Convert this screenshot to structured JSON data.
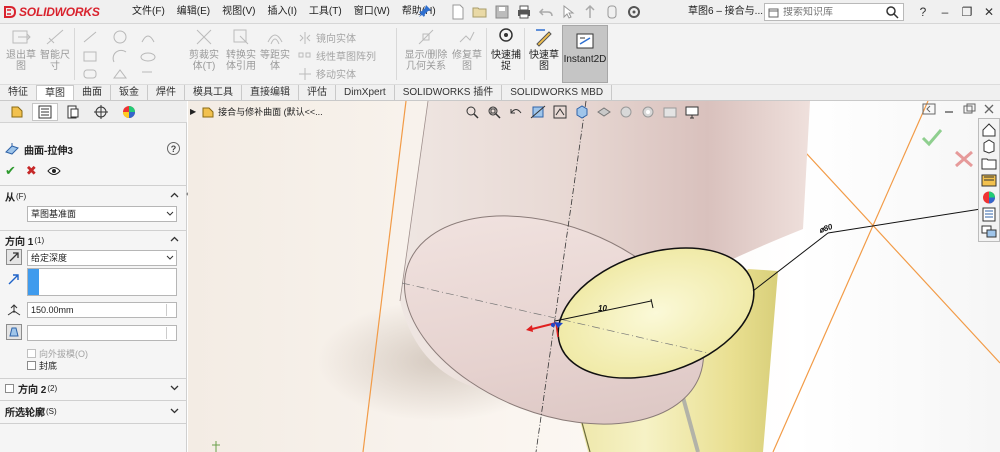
{
  "app": {
    "logo_text": "SOLIDWORKS",
    "doc_title": "草图6 – 接合与..."
  },
  "menu": [
    "文件(F)",
    "编辑(E)",
    "视图(V)",
    "插入(I)",
    "工具(T)",
    "窗口(W)",
    "帮助(H)"
  ],
  "search": {
    "placeholder": "搜索知识库"
  },
  "command_manager": {
    "exit_sketch": "退出草\n图",
    "smart_dim": "智能尺\n寸",
    "trim": "剪裁实\n体(T)",
    "convert": "转换实\n体引用",
    "offset": "等距实\n体",
    "mirror": "镜向实体",
    "linear_pattern": "线性草图阵列",
    "move": "移动实体",
    "display_delete": "显示/删除\n几何关系",
    "repair": "修复草\n图",
    "quick_snap": "快速捕\n捉",
    "rapid_sketch": "快速草\n图",
    "instant2d": "Instant2D"
  },
  "tabs": [
    "特征",
    "草图",
    "曲面",
    "钣金",
    "焊件",
    "模具工具",
    "直接编辑",
    "评估",
    "DimXpert",
    "SOLIDWORKS 插件",
    "SOLIDWORKS MBD"
  ],
  "active_tab": "草图",
  "property_manager": {
    "title": "曲面-拉伸3",
    "from_label": "从",
    "from_sub": "(F)",
    "from_value": "草图基准面",
    "dir1_label": "方向 1",
    "dir1_sub": "(1)",
    "end_condition": "给定深度",
    "depth": "150.00mm",
    "draft_outward": "向外拔模(O)",
    "cap_end": "封底",
    "dir2_label": "方向 2",
    "dir2_sub": "(2)",
    "contours_label": "所选轮廓",
    "contours_sub": "(S)"
  },
  "graphics": {
    "tree_label": "接合与修补曲面 (默认<<..."
  },
  "dimensions": {
    "radius": "10",
    "diameter": "⌀80"
  },
  "colors": {
    "brand_red": "#d9232e",
    "accent_blue": "#3f9bed",
    "sketch_orange": "#f29b47",
    "surface_pink": "#eadad6",
    "surface_yellow": "#eeeaa0"
  }
}
